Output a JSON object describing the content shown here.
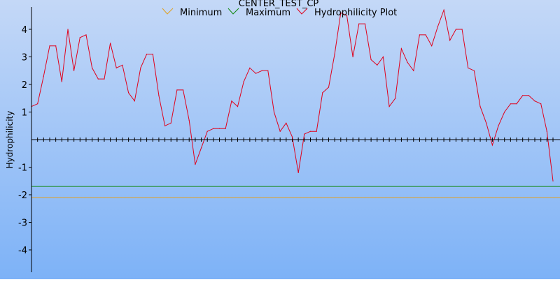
{
  "chart_data": {
    "type": "line",
    "title": "CENTER_TEST_CP",
    "xlabel": "",
    "ylabel": "Hydrophilicity",
    "ylim": [
      -4.8,
      4.8
    ],
    "yticks": [
      {
        "value": 4,
        "label": "4"
      },
      {
        "value": 3,
        "label": "3"
      },
      {
        "value": 2,
        "label": "2"
      },
      {
        "value": 1,
        "label": "1"
      },
      {
        "value": -1,
        "label": "-1"
      },
      {
        "value": -2,
        "label": "-2"
      },
      {
        "value": -3,
        "label": "-3"
      },
      {
        "value": -4,
        "label": "-4"
      }
    ],
    "legend_position": "top",
    "background_gradient": [
      "#c4d8f7",
      "#7db2f7"
    ],
    "series": [
      {
        "name": "Minimum",
        "color": "#e0a020",
        "kind": "hline",
        "value": -2.1
      },
      {
        "name": "Maximum",
        "color": "#118811",
        "kind": "hline",
        "value": -1.7
      },
      {
        "name": "Hydrophilicity Plot",
        "color": "#e0001b",
        "kind": "line",
        "values": [
          1.2,
          1.3,
          2.3,
          3.4,
          3.4,
          2.1,
          4.0,
          2.5,
          3.7,
          3.8,
          2.6,
          2.2,
          2.2,
          3.5,
          2.6,
          2.7,
          1.7,
          1.4,
          2.6,
          3.1,
          3.1,
          1.6,
          0.5,
          0.6,
          1.8,
          1.8,
          0.7,
          -0.9,
          -0.3,
          0.3,
          0.4,
          0.4,
          0.4,
          1.4,
          1.2,
          2.1,
          2.6,
          2.4,
          2.5,
          2.5,
          1.0,
          0.3,
          0.6,
          0.1,
          -1.2,
          0.2,
          0.3,
          0.3,
          1.7,
          1.9,
          3.1,
          4.6,
          4.5,
          3.0,
          4.2,
          4.2,
          2.9,
          2.7,
          3.0,
          1.2,
          1.5,
          3.3,
          2.8,
          2.5,
          3.8,
          3.8,
          3.4,
          4.1,
          4.7,
          3.6,
          4.0,
          4.0,
          2.6,
          2.5,
          1.2,
          0.6,
          -0.2,
          0.5,
          1.0,
          1.3,
          1.3,
          1.6,
          1.6,
          1.4,
          1.3,
          0.3,
          -1.5
        ]
      }
    ]
  }
}
